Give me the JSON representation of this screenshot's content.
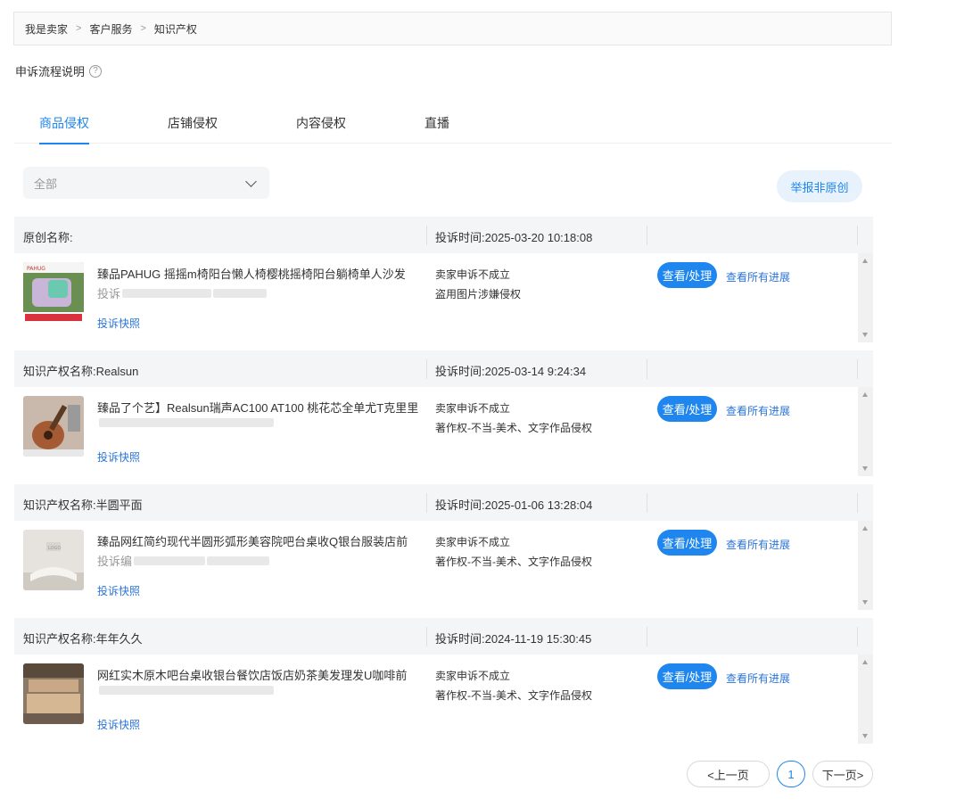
{
  "breadcrumb": [
    "我是卖家",
    "客户服务",
    "知识产权"
  ],
  "breadcrumb_sep": ">",
  "process_label": "申诉流程说明",
  "tabs": [
    "商品侵权",
    "店铺侵权",
    "内容侵权",
    "直播"
  ],
  "active_tab": 0,
  "filter": {
    "selected": "全部"
  },
  "report_button": "举报非原创",
  "snapshot_label": "投诉快照",
  "view_button": "查看/处理",
  "progress_link": "查看所有进展",
  "complaints": [
    {
      "ip_name": "原创名称:",
      "time": "投诉时间:2025-03-20 10:18:08",
      "title": "臻品PAHUG 摇摇m椅阳台懒人椅樱桃摇椅阳台躺椅单人沙发",
      "sub": "投诉",
      "status": "卖家申诉不成立",
      "reason": "盗用图片涉嫌侵权",
      "thumb_icon": "rocking-chair-product-image"
    },
    {
      "ip_name": "知识产权名称:Realsun",
      "time": "投诉时间:2025-03-14 9:24:34",
      "title": "臻品了个艺】Realsun瑞声AC100 AT100 桃花芯全单尤T克里里",
      "sub": "",
      "status": "卖家申诉不成立",
      "reason": "著作权-不当-美术、文字作品侵权",
      "thumb_icon": "ukulele-product-image"
    },
    {
      "ip_name": "知识产权名称:半圆平面",
      "time": "投诉时间:2025-01-06 13:28:04",
      "title": "臻品网红简约现代半圆形弧形美容院吧台桌收Q银台服装店前",
      "sub": "投诉编",
      "status": "卖家申诉不成立",
      "reason": "著作权-不当-美术、文字作品侵权",
      "thumb_icon": "reception-desk-product-image"
    },
    {
      "ip_name": "知识产权名称:年年久久",
      "time": "投诉时间:2024-11-19 15:30:45",
      "title": "网红实木原木吧台桌收银台餐饮店饭店奶茶美发理发U咖啡前",
      "sub": "",
      "status": "卖家申诉不成立",
      "reason": "著作权-不当-美术、文字作品侵权",
      "thumb_icon": "wood-counter-product-image"
    }
  ],
  "pagination": {
    "prev": "<上一页",
    "current": "1",
    "next": "下一页>"
  },
  "colors": {
    "accent": "#1e86ee",
    "link": "#2a74d6",
    "header_bg": "#f4f5f7"
  }
}
